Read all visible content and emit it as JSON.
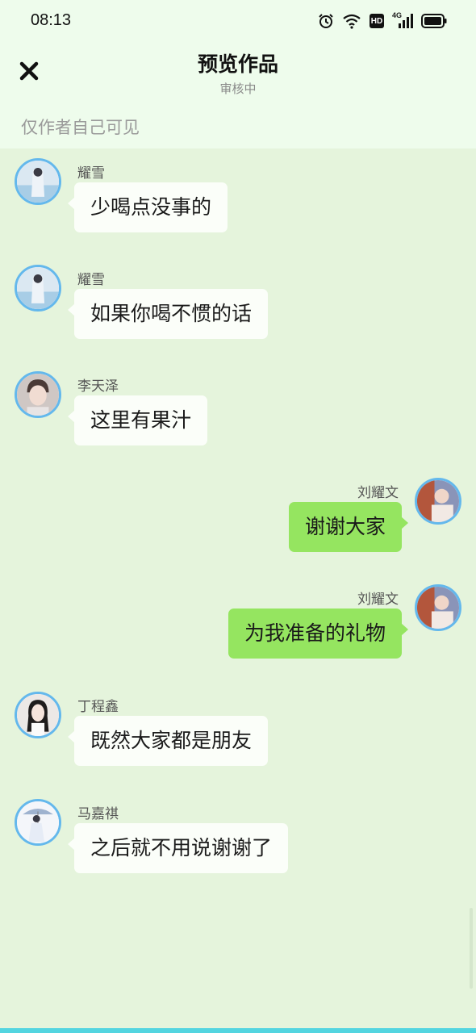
{
  "status_bar": {
    "time": "08:13",
    "icons": [
      "alarm-icon",
      "wifi-icon",
      "hd-icon",
      "cellular-4g-icon",
      "battery-icon"
    ],
    "network_label": "4G",
    "hd_label": "HD"
  },
  "header": {
    "title": "预览作品",
    "subtitle": "审核中",
    "close_icon": "close-icon"
  },
  "visibility_note": "仅作者自己可见",
  "colors": {
    "background": "#e5f4dc",
    "header_background": "#eefcec",
    "bubble_left": "#fbfef9",
    "bubble_right": "#95e560",
    "avatar_border": "#64b8ec",
    "bottom_bar": "#53d5e0"
  },
  "messages": [
    {
      "side": "left",
      "name": "耀雪",
      "text": "少喝点没事的",
      "avatar": "avatar-yaoxue"
    },
    {
      "side": "left",
      "name": "耀雪",
      "text": "如果你喝不惯的话",
      "avatar": "avatar-yaoxue"
    },
    {
      "side": "left",
      "name": "李天泽",
      "text": "这里有果汁",
      "avatar": "avatar-litianze"
    },
    {
      "side": "right",
      "name": "刘耀文",
      "text": "谢谢大家",
      "avatar": "avatar-liuyaowen"
    },
    {
      "side": "right",
      "name": "刘耀文",
      "text": "为我准备的礼物",
      "avatar": "avatar-liuyaowen"
    },
    {
      "side": "left",
      "name": "丁程鑫",
      "text": "既然大家都是朋友",
      "avatar": "avatar-dingchengxin"
    },
    {
      "side": "left",
      "name": "马嘉祺",
      "text": "之后就不用说谢谢了",
      "avatar": "avatar-majiaqi"
    }
  ]
}
